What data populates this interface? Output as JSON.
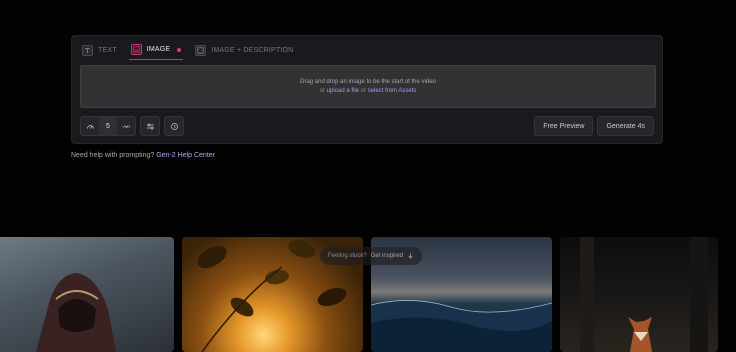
{
  "tabs": [
    {
      "label": "TEXT",
      "icon": "text-icon"
    },
    {
      "label": "IMAGE",
      "icon": "image-icon",
      "active": true
    },
    {
      "label": "IMAGE + DESCRIPTION",
      "icon": "image-description-icon"
    }
  ],
  "dropzone": {
    "line1": "Drag and drop an image to be the start of the video",
    "upload_link": "upload a file",
    "or1": "or",
    "or2": "or",
    "assets_link": "select from Assets"
  },
  "controls": {
    "seed_value": "5",
    "icons": [
      "gauge-icon",
      "chevron-icon",
      "sliders-icon",
      "history-icon"
    ]
  },
  "actions": {
    "free_preview": "Free Preview",
    "generate": "Generate 4s"
  },
  "help": {
    "text": "Need help with prompting?",
    "link": "Gen-2 Help Center"
  },
  "inspired": {
    "text": "Feeling stuck?",
    "link": "Get inspired"
  },
  "colors": {
    "accent": "#e6337a",
    "link": "#a79be8",
    "background": "#020203"
  }
}
